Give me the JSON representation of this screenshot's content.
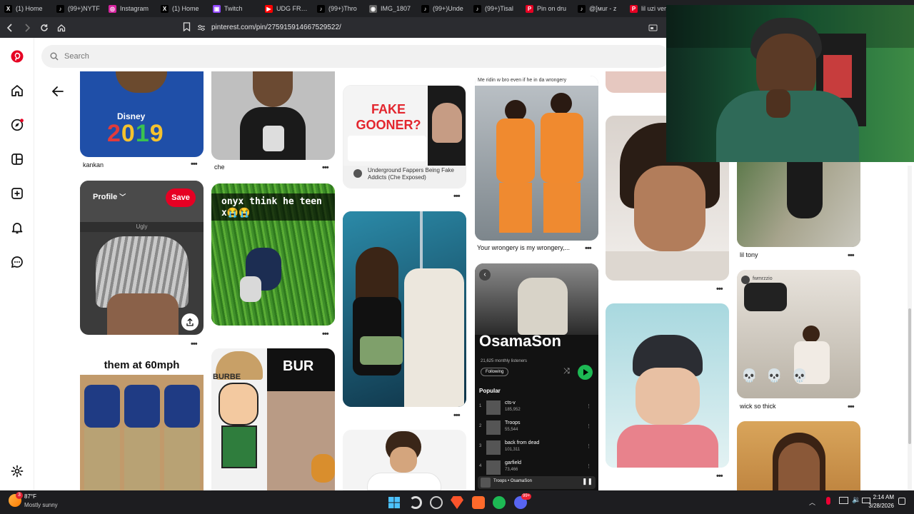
{
  "browser": {
    "tabs": [
      {
        "label": "(1) Home",
        "icon": "x-icon",
        "color": "#000000"
      },
      {
        "label": "(99+)NYTF",
        "icon": "tiktok-icon",
        "color": "#000000"
      },
      {
        "label": "Instagram",
        "icon": "instagram-icon",
        "color": "#d6249f"
      },
      {
        "label": "(1) Home",
        "icon": "x-icon",
        "color": "#000000"
      },
      {
        "label": "Twitch",
        "icon": "twitch-icon",
        "color": "#9146ff"
      },
      {
        "label": "UDG FRESH",
        "icon": "youtube-icon",
        "color": "#ff0000"
      },
      {
        "label": "(99+)Thro",
        "icon": "tiktok-icon",
        "color": "#000000"
      },
      {
        "label": "IMG_1807",
        "icon": "globe-icon",
        "color": "#666666"
      },
      {
        "label": "(99+)Unde",
        "icon": "tiktok-icon",
        "color": "#000000"
      },
      {
        "label": "(99+)Tisal",
        "icon": "tiktok-icon",
        "color": "#000000"
      },
      {
        "label": "Pin on dru",
        "icon": "pinterest-icon",
        "color": "#e60023"
      },
      {
        "label": "@[мur - z",
        "icon": "tiktok-icon",
        "color": "#000000"
      },
      {
        "label": "lil uzi vert",
        "icon": "pinterest-icon",
        "color": "#e60023"
      }
    ],
    "url": "pinterest.com/pin/275915914667529522/"
  },
  "app": {
    "search_placeholder": "Search",
    "brand_color": "#e60023"
  },
  "pins": {
    "c1": [
      {
        "caption": "kankan",
        "image_text": "2019"
      },
      {
        "overlay_profile": "Profile",
        "overlay_save": "Save",
        "top_label": "Ugly"
      },
      {
        "image_text": "them at 60mph"
      }
    ],
    "c2": [
      {
        "caption": "che"
      },
      {
        "image_text": "onyx think he teen x😭😭"
      },
      {
        "image_text_a": "BURBE",
        "image_text_b": "BUR"
      }
    ],
    "c3": [
      {
        "image_text": "FAKE GOONER?",
        "image_sub": "Underground Fappers Being Fake Addicts (Che Exposed)"
      },
      {}
    ],
    "c4": [
      {
        "top_text": "Me ridin w bro even if he in da wrongery",
        "caption": "Your wrongery is my wrongery,..."
      },
      {
        "title": "OsamaSon",
        "listeners": "21,625 monthly listeners",
        "following": "Following",
        "popular": "Popular",
        "tracks": [
          {
            "name": "cts-v",
            "plays": "185,952"
          },
          {
            "name": "Troops",
            "plays": "55,544"
          },
          {
            "name": "back from dead",
            "plays": "101,311"
          },
          {
            "name": "garfield",
            "plays": "73,466"
          }
        ],
        "now_playing": "Troops • OsamaSon"
      }
    ],
    "c6": [
      {
        "caption": "lil tony"
      },
      {
        "username": "fwmrzzio",
        "caption": "wick so thick",
        "emojis": "💀 💀 💀"
      }
    ]
  },
  "taskbar": {
    "temp": "87°F",
    "weather": "Mostly sunny",
    "weather_badge": "3",
    "time": "2:14 AM",
    "date": "3/28/2026",
    "discord_badge": "99+"
  }
}
